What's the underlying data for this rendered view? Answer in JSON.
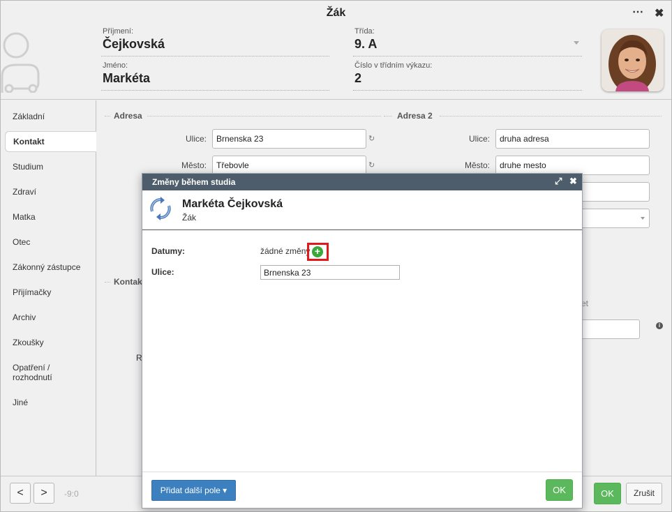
{
  "window": {
    "title": "Žák"
  },
  "header": {
    "surname_label": "Příjmení:",
    "surname_value": "Čejkovská",
    "firstname_label": "Jméno:",
    "firstname_value": "Markéta",
    "class_label": "Třída:",
    "class_value": "9. A",
    "number_label": "Číslo v třídním výkazu:",
    "number_value": "2"
  },
  "sidebar": {
    "items": [
      {
        "label": "Základní"
      },
      {
        "label": "Kontakt"
      },
      {
        "label": "Studium"
      },
      {
        "label": "Zdraví"
      },
      {
        "label": "Matka"
      },
      {
        "label": "Otec"
      },
      {
        "label": "Zákonný zástupce"
      },
      {
        "label": "Přijímačky"
      },
      {
        "label": "Archiv"
      },
      {
        "label": "Zkoušky"
      },
      {
        "label": "Opatření /\nrozhodnutí"
      },
      {
        "label": "Jiné"
      }
    ],
    "active": "Kontakt"
  },
  "address": {
    "title": "Adresa",
    "street_label": "Ulice:",
    "street_value": "Brnenska 23",
    "city_label": "Město:",
    "city_value": "Třebovle"
  },
  "address2": {
    "title": "Adresa 2",
    "street_label": "Ulice:",
    "street_value": "druha adresa",
    "city_label": "Město:",
    "city_value": "druhe mesto"
  },
  "contact": {
    "title_partial": "Kontak",
    "partial_label_r": "R",
    "partial_text_et": "et"
  },
  "bottombar": {
    "prev_label": "<",
    "next_label": ">",
    "page_counter": "-9:0",
    "ok_label": "OK",
    "cancel_label": "Zrušit"
  },
  "dialog": {
    "title": "Změny během studia",
    "person_name": "Markéta Čejkovská",
    "person_role": "Žák",
    "dates_label": "Datumy:",
    "dates_value": "žádné změny",
    "street_label": "Ulice:",
    "street_value": "Brnenska 23",
    "add_field_label": "Přidat další pole ▾",
    "ok_label": "OK"
  },
  "colors": {
    "dialog_header": "#4d5d6b",
    "ok_green": "#5cb85c",
    "primary_blue": "#3d80bf",
    "highlight_red": "#e01a1a"
  }
}
